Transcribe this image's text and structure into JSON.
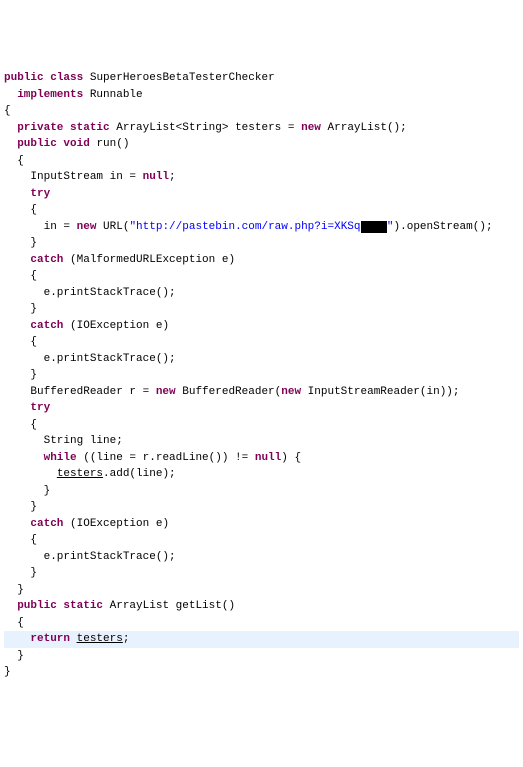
{
  "code": {
    "kw_public": "public",
    "kw_class": "class",
    "kw_implements": "implements",
    "kw_private": "private",
    "kw_static": "static",
    "kw_void": "void",
    "kw_new": "new",
    "kw_null": "null",
    "kw_try": "try",
    "kw_catch": "catch",
    "kw_while": "while",
    "kw_return": "return",
    "class_name": "SuperHeroesBetaTesterChecker",
    "interface": "Runnable",
    "type_arraylist": "ArrayList",
    "type_string": "String",
    "type_inputstream": "InputStream",
    "type_url": "URL",
    "type_malformed": "MalformedURLException",
    "type_ioexception": "IOException",
    "type_bufferedreader": "BufferedReader",
    "type_inputstreamreader": "InputStreamReader",
    "field_testers": "testers",
    "method_run": "run",
    "method_getlist": "getList",
    "var_in": "in",
    "var_e": "e",
    "var_r": "r",
    "var_line": "line",
    "url_string": "\"http://pastebin.com/raw.php?i=XKSq",
    "url_end": "\"",
    "redacted": "XXXX",
    "call_openstream": ".openStream();",
    "call_printstack": "e.printStackTrace();",
    "call_readline": "r.readLine()",
    "call_add": ".add(line);",
    "decl_arraylist": " ArrayList<String> testers = ",
    "init_arraylist": " ArrayList();",
    "decl_in": "InputStream in = ",
    "semicolon_null": ";",
    "assign_in": "in = ",
    "url_paren": " URL(",
    "decl_reader": "BufferedReader r = ",
    "reader_ctor": " BufferedReader(",
    "isr_ctor": " InputStreamReader(in));",
    "decl_line": "String line;",
    "while_cond": " ((line = r.readLine()) != ",
    "while_end": ") {",
    "testers_add": ".add(line);",
    "getlist_sig": " ArrayList getList()",
    "return_end": ";"
  }
}
